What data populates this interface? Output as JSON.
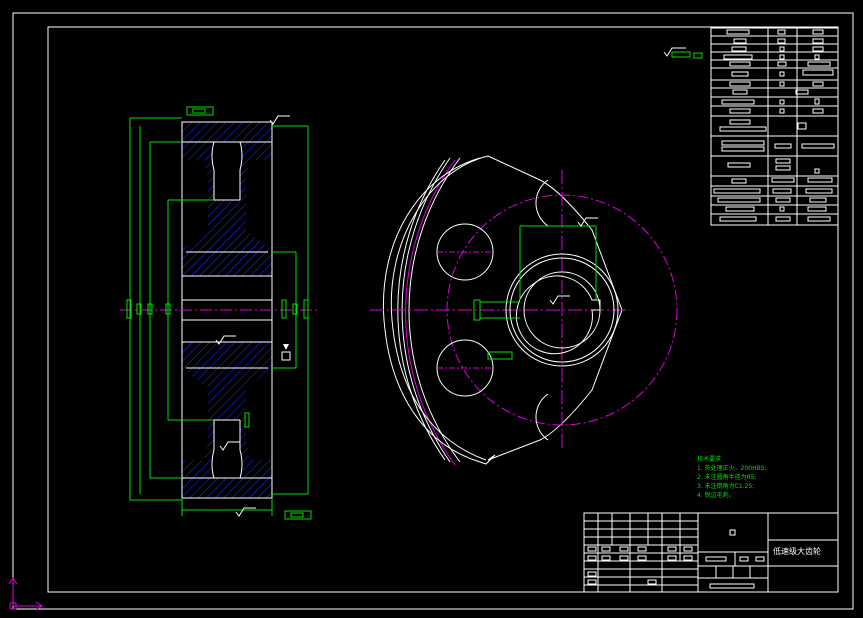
{
  "drawing": {
    "title": "低速级大齿轮",
    "background": "#000000",
    "colors": {
      "outline": "#ffffff",
      "dimension": "#00e000",
      "centerline": "#e000e0",
      "hatch": "#2a2aff"
    }
  },
  "technical_requirements": {
    "heading": "技术要求",
    "items": [
      "1. 热处理正火，200HBS;",
      "2. 未注圆角半径为R5;",
      "3. 未注倒角为C1.25;",
      "4. 锐边毛刺。"
    ]
  },
  "views": [
    {
      "name": "section-view"
    },
    {
      "name": "front-view"
    }
  ],
  "icons": {
    "ucs": "ucs-axis-icon",
    "roughness": "surface-roughness-icon"
  }
}
